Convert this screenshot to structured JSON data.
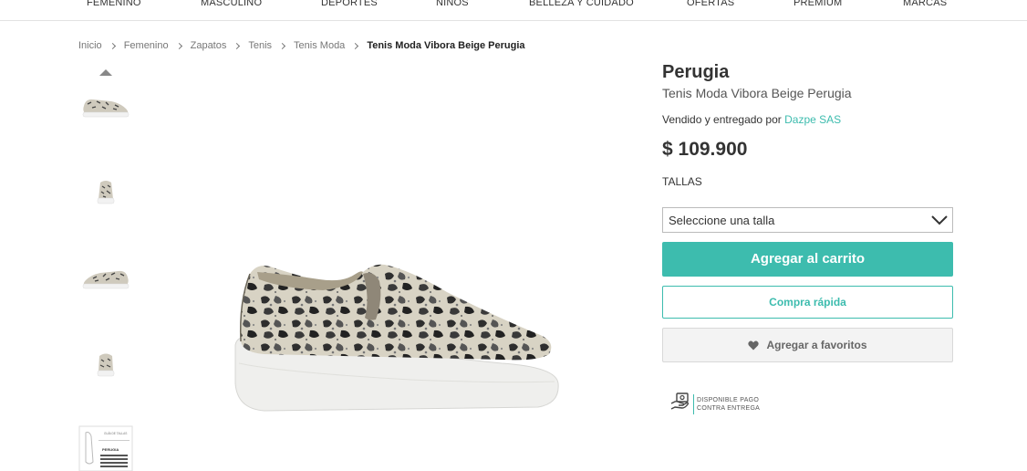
{
  "nav": {
    "items": [
      "FEMENINO",
      "MASCULINO",
      "DEPORTES",
      "NIÑOS",
      "BELLEZA Y CUIDADO",
      "OFERTAS",
      "PREMIUM",
      "MARCAS"
    ]
  },
  "breadcrumb": {
    "items": [
      "Inicio",
      "Femenino",
      "Zapatos",
      "Tenis",
      "Tenis Moda"
    ],
    "current": "Tenis Moda Vibora Beige Perugia"
  },
  "product": {
    "brand": "Perugia",
    "name": "Tenis Moda Vibora Beige Perugia",
    "seller_prefix": "Vendido y entregado por",
    "seller_name": "Dazpe SAS",
    "price": "$ 109.900",
    "sizes_label": "TALLAS",
    "size_select_value": "Seleccione una talla"
  },
  "actions": {
    "add_to_cart": "Agregar al carrito",
    "quick_buy": "Compra rápida",
    "favorites": "Agregar a favoritos"
  },
  "cod": {
    "line1": "DISPONIBLE PAGO",
    "line2": "CONTRA ENTREGA"
  },
  "thumbnails": {
    "size_guide_title": "GUÍA DE TALLAS",
    "size_guide_brand": "PERUGIA"
  },
  "colors": {
    "accent": "#3dbcae",
    "text": "#333333"
  }
}
